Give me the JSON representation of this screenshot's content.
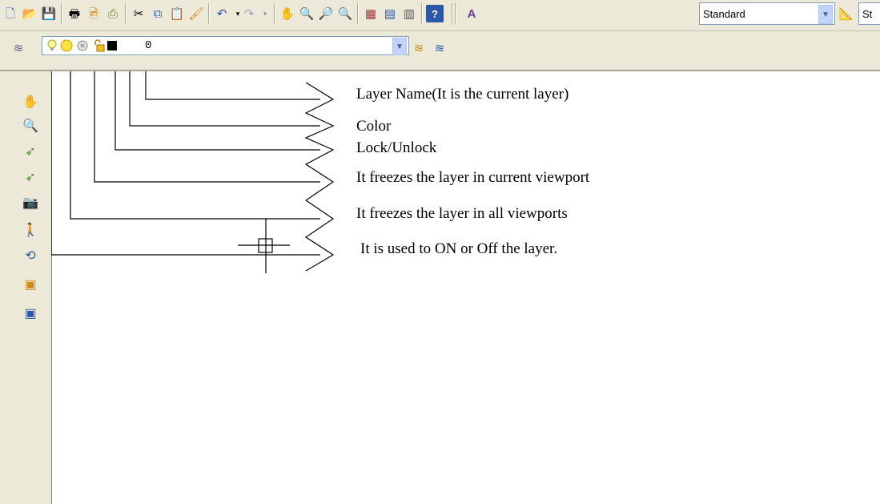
{
  "toolbar": {
    "text_style_value": "Standard",
    "dim_style_value_partial": "St"
  },
  "layer_toolbar": {
    "current_layer": "0"
  },
  "annotations": {
    "layer_name": "Layer Name(It is the current layer)",
    "color": "Color",
    "lock": "Lock/Unlock",
    "freeze_current": "It freezes the layer in current viewport",
    "freeze_all": "It freezes the layer in all viewports",
    "on_off": "It is used to ON or Off the layer."
  },
  "colors": {
    "toolbar_bg": "#ece9d8",
    "canvas_bg": "#ffffff",
    "line": "#000000"
  }
}
